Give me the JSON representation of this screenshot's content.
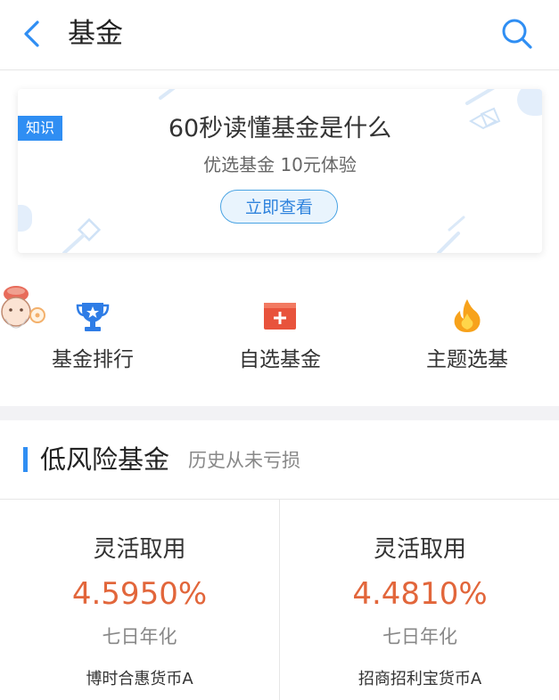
{
  "header": {
    "title": "基金",
    "back_icon": "chevron-left-icon",
    "search_icon": "search-icon",
    "accent_color": "#2f8ef3"
  },
  "banner": {
    "tag": "知识",
    "title": "60秒读懂基金是什么",
    "subtitle": "优选基金  10元体验",
    "button_label": "立即查看"
  },
  "quick_entries": [
    {
      "label": "基金排行",
      "icon": "trophy-icon"
    },
    {
      "label": "自选基金",
      "icon": "add-box-icon"
    },
    {
      "label": "主题选基",
      "icon": "flame-icon"
    }
  ],
  "section": {
    "title": "低风险基金",
    "subtitle": "历史从未亏损"
  },
  "funds": [
    {
      "tag": "灵活取用",
      "rate": "4.5950%",
      "rate_label": "七日年化",
      "name": "博时合惠货币A"
    },
    {
      "tag": "灵活取用",
      "rate": "4.4810%",
      "rate_label": "七日年化",
      "name": "招商招利宝货币A"
    }
  ],
  "colors": {
    "rate": "#e2663b",
    "accent": "#2f8ef3",
    "divider": "#f2f2f5"
  }
}
